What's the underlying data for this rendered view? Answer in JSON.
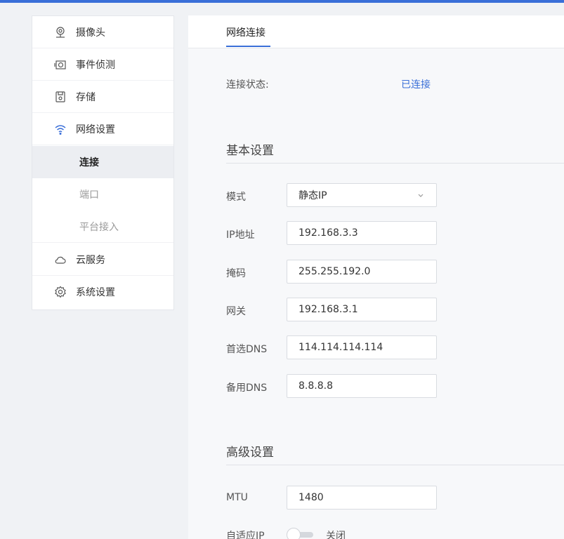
{
  "sidebar": {
    "items": [
      {
        "label": "摄像头",
        "icon": "map-pin-icon"
      },
      {
        "label": "事件侦测",
        "icon": "camera-icon"
      },
      {
        "label": "存储",
        "icon": "storage-icon"
      },
      {
        "label": "网络设置",
        "icon": "wifi-icon"
      },
      {
        "label": "云服务",
        "icon": "cloud-icon"
      },
      {
        "label": "系统设置",
        "icon": "gear-icon"
      }
    ],
    "sub_items": [
      {
        "label": "连接",
        "active": true
      },
      {
        "label": "端口",
        "active": false
      },
      {
        "label": "平台接入",
        "active": false
      }
    ]
  },
  "tabs": [
    "网络连接"
  ],
  "status": {
    "label": "连接状态:",
    "value": "已连接"
  },
  "basic": {
    "title": "基本设置",
    "mode": {
      "label": "模式",
      "value": "静态IP"
    },
    "ip": {
      "label": "IP地址",
      "value": "192.168.3.3"
    },
    "mask": {
      "label": "掩码",
      "value": "255.255.192.0"
    },
    "gateway": {
      "label": "网关",
      "value": "192.168.3.1"
    },
    "dns1": {
      "label": "首选DNS",
      "value": "114.114.114.114"
    },
    "dns2": {
      "label": "备用DNS",
      "value": "8.8.8.8"
    }
  },
  "advanced": {
    "title": "高级设置",
    "mtu": {
      "label": "MTU",
      "value": "1480"
    },
    "adaptive_ip": {
      "label": "自适应IP",
      "state_text": "关闭",
      "enabled": false
    }
  },
  "colors": {
    "accent": "#3a6fd8"
  }
}
